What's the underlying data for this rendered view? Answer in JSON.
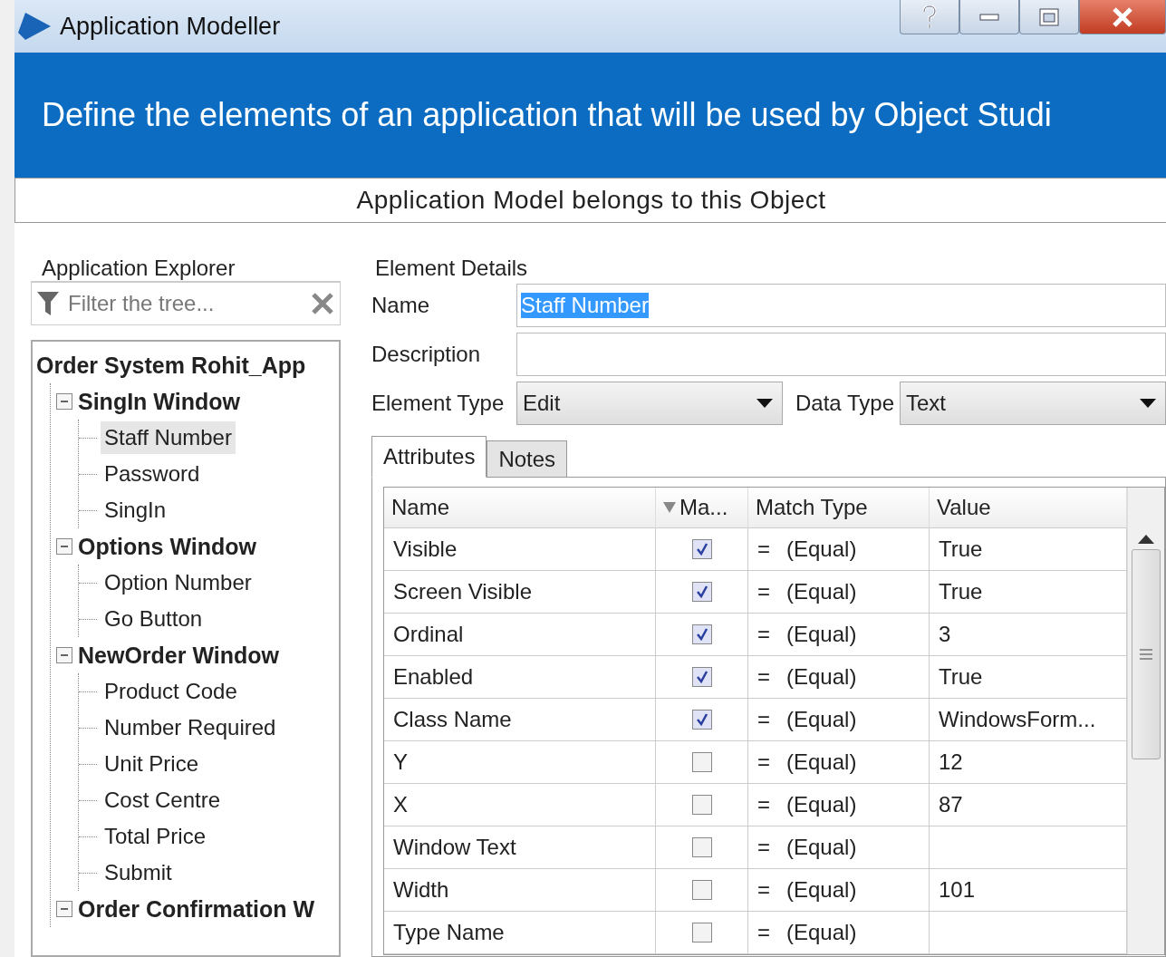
{
  "window": {
    "title": "Application Modeller"
  },
  "banner": "Define the elements of an application that will be used by Object Studi",
  "subheader": "Application Model belongs to this Object",
  "explorer": {
    "title": "Application Explorer",
    "filter": {
      "placeholder": "Filter the tree..."
    },
    "tree": {
      "label": "Order System Rohit_App",
      "selected": false,
      "children": [
        {
          "label": "SingIn Window",
          "expanded": true,
          "selected": false,
          "children": [
            {
              "label": "Staff Number",
              "selected": true
            },
            {
              "label": "Password",
              "selected": false
            },
            {
              "label": "SingIn",
              "selected": false
            }
          ]
        },
        {
          "label": "Options Window",
          "expanded": true,
          "selected": false,
          "children": [
            {
              "label": "Option Number",
              "selected": false
            },
            {
              "label": "Go Button",
              "selected": false
            }
          ]
        },
        {
          "label": "NewOrder Window",
          "expanded": true,
          "selected": false,
          "children": [
            {
              "label": "Product Code",
              "selected": false
            },
            {
              "label": "Number Required",
              "selected": false
            },
            {
              "label": "Unit Price",
              "selected": false
            },
            {
              "label": "Cost Centre",
              "selected": false
            },
            {
              "label": "Total Price",
              "selected": false
            },
            {
              "label": "Submit",
              "selected": false
            }
          ]
        },
        {
          "label": "Order Confirmation W",
          "expanded": true,
          "selected": false
        }
      ]
    }
  },
  "details": {
    "title": "Element Details",
    "name_label": "Name",
    "name_value": "Staff Number",
    "description_label": "Description",
    "element_type_label": "Element Type",
    "element_type": "Edit",
    "data_type_label": "Data Type",
    "data_type": "Text"
  },
  "tabs": [
    {
      "label": "Attributes",
      "selected": true
    },
    {
      "label": "Notes",
      "selected": false
    }
  ],
  "table": {
    "columns": [
      "Name",
      "Ma...",
      "Match Type",
      "Value"
    ],
    "rows": [
      {
        "name": "Visible",
        "checked": true,
        "match_op": "=",
        "match": "(Equal)",
        "value": "True"
      },
      {
        "name": "Screen Visible",
        "checked": true,
        "match_op": "=",
        "match": "(Equal)",
        "value": "True"
      },
      {
        "name": "Ordinal",
        "checked": true,
        "match_op": "=",
        "match": "(Equal)",
        "value": "3"
      },
      {
        "name": "Enabled",
        "checked": true,
        "match_op": "=",
        "match": "(Equal)",
        "value": "True"
      },
      {
        "name": "Class Name",
        "checked": true,
        "match_op": "=",
        "match": "(Equal)",
        "value": "WindowsForm..."
      },
      {
        "name": "Y",
        "checked": false,
        "match_op": "=",
        "match": "(Equal)",
        "value": "12"
      },
      {
        "name": "X",
        "checked": false,
        "match_op": "=",
        "match": "(Equal)",
        "value": "87"
      },
      {
        "name": "Window Text",
        "checked": false,
        "match_op": "=",
        "match": "(Equal)",
        "value": ""
      },
      {
        "name": "Width",
        "checked": false,
        "match_op": "=",
        "match": "(Equal)",
        "value": "101"
      },
      {
        "name": "Type Name",
        "checked": false,
        "match_op": "=",
        "match": "(Equal)",
        "value": ""
      }
    ]
  }
}
